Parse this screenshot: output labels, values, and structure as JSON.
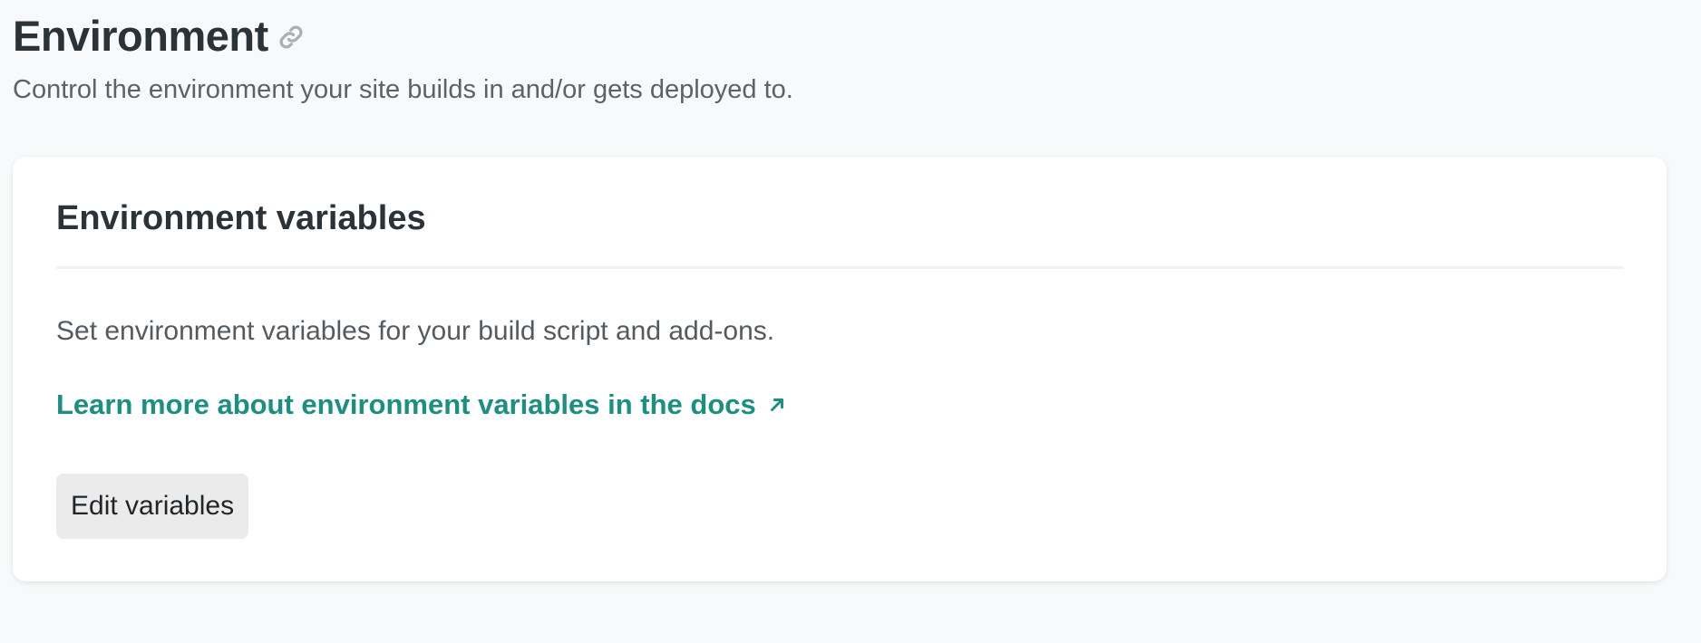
{
  "header": {
    "title": "Environment",
    "subtitle": "Control the environment your site builds in and/or gets deployed to.",
    "anchor_icon": "link-icon"
  },
  "card": {
    "title": "Environment variables",
    "description": "Set environment variables for your build script and add-ons.",
    "docs_link_label": "Learn more about environment variables in the docs",
    "docs_link_icon": "external-arrow-icon",
    "edit_button_label": "Edit variables"
  },
  "colors": {
    "background": "#f7f9fa",
    "card": "#ffffff",
    "link": "#1b8f80",
    "button": "#ebebeb",
    "text": "#2b3338"
  }
}
